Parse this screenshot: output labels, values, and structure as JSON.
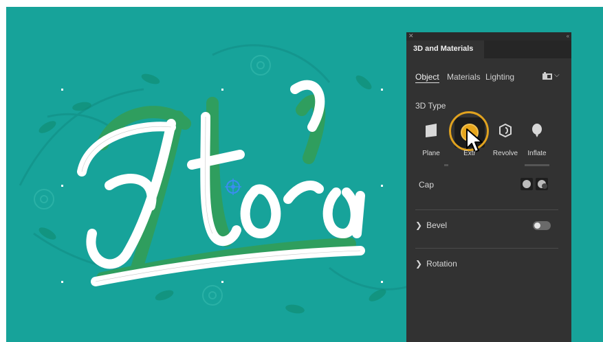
{
  "canvas": {
    "background": "#17a39a",
    "artwork_word": "Flora",
    "artwork_color": "#ffffff",
    "extrude_color": "#3cb46a"
  },
  "panel": {
    "title": "3D and Materials",
    "close_icon": "close-icon",
    "collapse_icon": "collapse-double-chevron-icon",
    "subtabs": [
      {
        "label": "Object",
        "active": true
      },
      {
        "label": "Materials",
        "active": false
      },
      {
        "label": "Lighting",
        "active": false
      }
    ],
    "presets_icon": "presets-icon",
    "section_3d_type": "3D Type",
    "types": [
      {
        "label": "Plane",
        "icon": "plane-icon"
      },
      {
        "label": "Extrude",
        "icon": "extrude-icon",
        "selected": true
      },
      {
        "label": "Revolve",
        "icon": "revolve-icon"
      },
      {
        "label": "Inflate",
        "icon": "inflate-icon"
      }
    ],
    "extrude_visible_label": "Extr",
    "cap_label": "Cap",
    "bevel_label": "Bevel",
    "rotation_label": "Rotation",
    "highlight_color": "#e0a21f"
  }
}
